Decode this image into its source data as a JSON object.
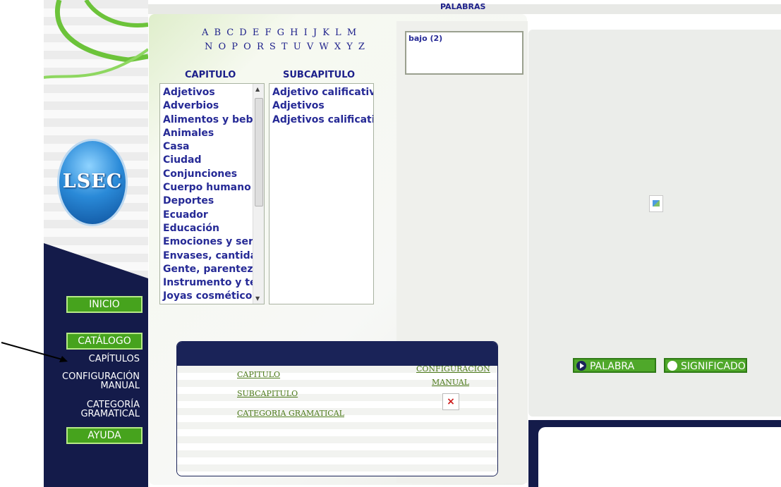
{
  "nav": {
    "logo_text": "LSEC",
    "inicio": "INICIO",
    "catalogo": "CATÁLOGO",
    "capitulos": "CAPÍTULOS",
    "configuracion_1": "CONFIGURACIÓN",
    "configuracion_2": "MANUAL",
    "categoria_1": "CATEGORÍA",
    "categoria_2": "GRAMATICAL",
    "ayuda": "AYUDA"
  },
  "alphabet": {
    "row1": "A B C D E F G H I J K L M",
    "row2": "N O P O R S T U V W X Y Z"
  },
  "headers": {
    "capitulo": "CAPITULO",
    "subcapitulo": "SUBCAPITULO",
    "palabras": "PALABRAS"
  },
  "capitulos": [
    "Adjetivos",
    "Adverbios",
    "Alimentos y beb",
    "Animales",
    "Casa",
    "Ciudad",
    "Conjunciones",
    "Cuerpo humano",
    "Deportes",
    "Ecuador",
    "Educación",
    "Emociones y ser",
    "Envases, cantida",
    "Gente, parentez",
    "Instrumento y te",
    "Joyas cosmético"
  ],
  "subcapitulos": [
    "Adjetivo calificativ",
    "Adjetivos",
    "Adjetivos calificati"
  ],
  "palabras": [
    "bajo (2)"
  ],
  "card": {
    "capitulo": "CAPITULO",
    "subcapitulo": "SUBCAPITULO",
    "categoria": "CATEGORIA GRAMATICAL",
    "config_1": "CONFIGURACION",
    "config_2": "MANUAL",
    "broken_glyph": "×"
  },
  "buttons": {
    "palabra": "PALABRA",
    "significado": "SIGNIFICADO"
  },
  "colors": {
    "navy": "#141b4a",
    "green": "#46a31d",
    "link_blue": "#262a96"
  }
}
